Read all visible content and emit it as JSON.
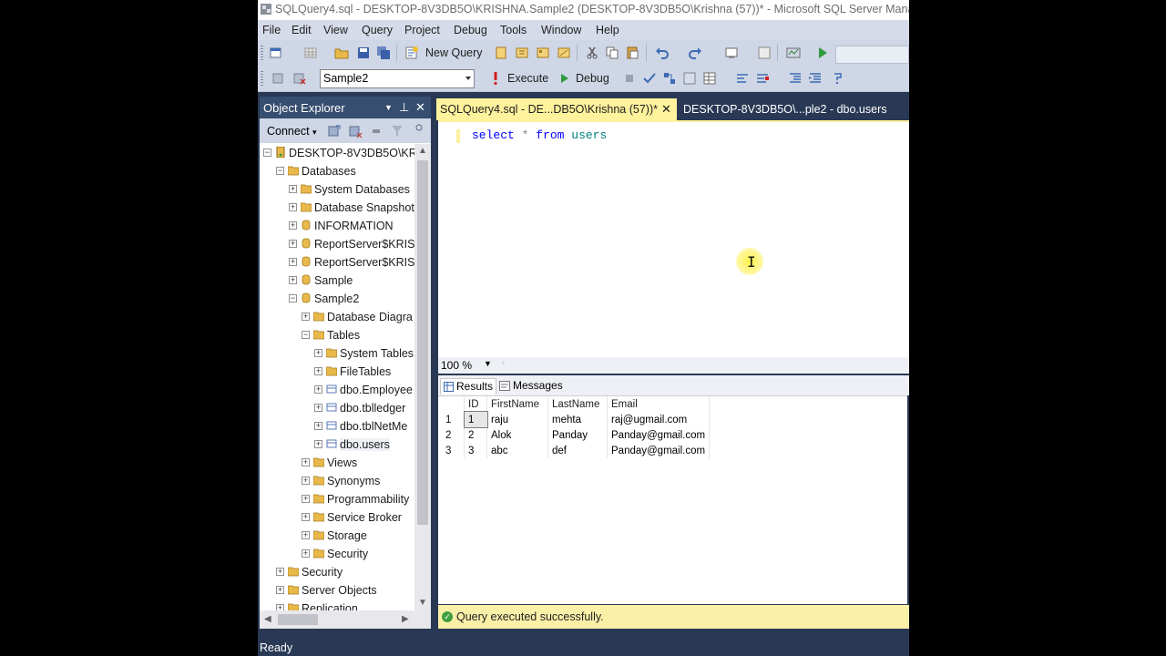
{
  "window": {
    "title": "SQLQuery4.sql - DESKTOP-8V3DB5O\\KRISHNA.Sample2 (DESKTOP-8V3DB5O\\Krishna (57))* - Microsoft SQL Server Manage"
  },
  "menu": [
    "File",
    "Edit",
    "View",
    "Query",
    "Project",
    "Debug",
    "Tools",
    "Window",
    "Help"
  ],
  "toolbar": {
    "new_query_label": "New Query",
    "database": "Sample2",
    "execute_label": "Execute",
    "debug_label": "Debug"
  },
  "object_explorer": {
    "title": "Object Explorer",
    "connect_label": "Connect",
    "server": "DESKTOP-8V3DB5O\\KR",
    "nodes": [
      {
        "label": "Databases"
      },
      {
        "label": "System Databases"
      },
      {
        "label": "Database Snapshot"
      },
      {
        "label": "INFORMATION"
      },
      {
        "label": "ReportServer$KRISI"
      },
      {
        "label": "ReportServer$KRISI"
      },
      {
        "label": "Sample"
      },
      {
        "label": "Sample2"
      },
      {
        "label": "Database Diagra"
      },
      {
        "label": "Tables"
      },
      {
        "label": "System Tables"
      },
      {
        "label": "FileTables"
      },
      {
        "label": "dbo.Employee"
      },
      {
        "label": "dbo.tblledger"
      },
      {
        "label": "dbo.tblNetMe"
      },
      {
        "label": "dbo.users"
      },
      {
        "label": "Views"
      },
      {
        "label": "Synonyms"
      },
      {
        "label": "Programmability"
      },
      {
        "label": "Service Broker"
      },
      {
        "label": "Storage"
      },
      {
        "label": "Security"
      },
      {
        "label": "Security"
      },
      {
        "label": "Server Objects"
      },
      {
        "label": "Replication"
      }
    ]
  },
  "tabs": {
    "active": "SQLQuery4.sql - DE...DB5O\\Krishna (57))*",
    "inactive": "DESKTOP-8V3DB5O\\...ple2 - dbo.users"
  },
  "editor": {
    "kw_select": "select",
    "star": "*",
    "kw_from": "from",
    "table": "users"
  },
  "zoom": "100 %",
  "results": {
    "tab_results": "Results",
    "tab_messages": "Messages",
    "columns": [
      "ID",
      "FirstName",
      "LastName",
      "Email"
    ],
    "rows": [
      {
        "n": "1",
        "id": "1",
        "first": "raju",
        "last": "mehta",
        "email": "raj@ugmail.com"
      },
      {
        "n": "2",
        "id": "2",
        "first": "Alok",
        "last": "Panday",
        "email": "Panday@gmail.com"
      },
      {
        "n": "3",
        "id": "3",
        "first": "abc",
        "last": "def",
        "email": "Panday@gmail.com"
      }
    ]
  },
  "query_status": "Query executed successfully.",
  "status": "Ready",
  "colors": {
    "chrome": "#293955",
    "active_tab": "#fff29d",
    "status_ok": "#fbf0a8"
  }
}
